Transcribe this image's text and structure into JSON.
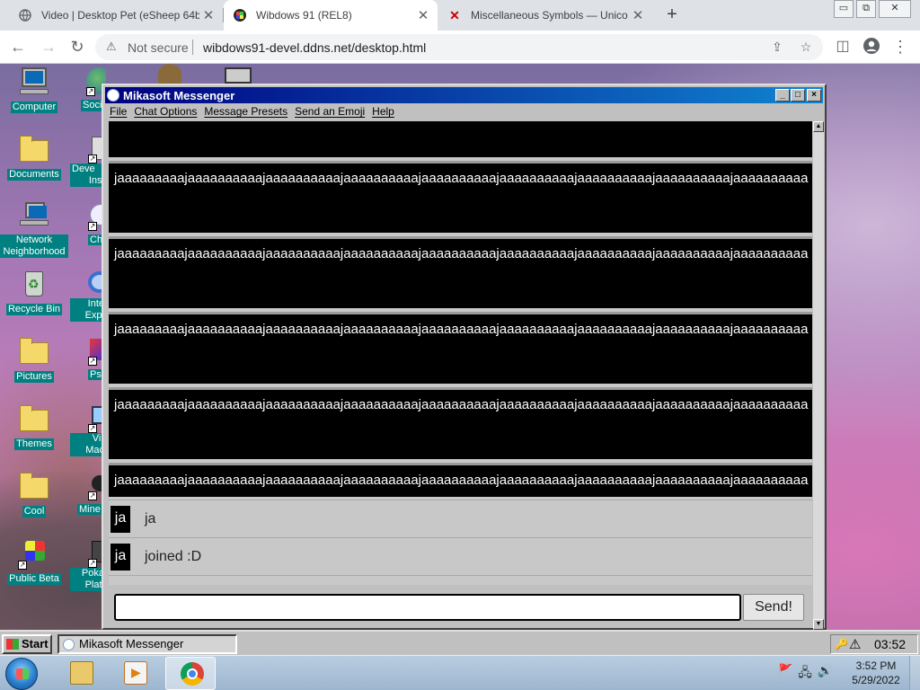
{
  "browser": {
    "tabs": [
      {
        "title": "Video | Desktop Pet (eSheep 64b",
        "active": false
      },
      {
        "title": "Wibdows 91 (REL8)",
        "active": true
      },
      {
        "title": "Miscellaneous Symbols — Unico",
        "active": false
      }
    ],
    "new_tab": "+",
    "window_controls": {
      "minimize": "▭",
      "restore": "⧉",
      "close": "✕"
    },
    "nav": {
      "back": "←",
      "forward": "→",
      "reload": "↻"
    },
    "address": {
      "security_label": "Not secure",
      "url": "wibdows91-devel.ddns.net/desktop.html"
    },
    "actions": {
      "share": "⇪",
      "bookmark": "☆",
      "sidepanel": "◫",
      "profile": "●",
      "menu": "⋮"
    }
  },
  "desktop": {
    "icons": [
      {
        "label": "Computer"
      },
      {
        "label": "Documents"
      },
      {
        "label": "Network Neighborhood"
      },
      {
        "label": "Recycle Bin"
      },
      {
        "label": "Pictures"
      },
      {
        "label": "Themes"
      },
      {
        "label": "Cool"
      },
      {
        "label": "Public Beta"
      }
    ],
    "partial_icons": [
      {
        "label": "Soci"
      },
      {
        "label": "Deve"
      },
      {
        "label": "Insi"
      },
      {
        "label": "Ch"
      },
      {
        "label": "Inte"
      },
      {
        "label": "Expl"
      },
      {
        "label": "Ps"
      },
      {
        "label": "Vir"
      },
      {
        "label": "Mac"
      },
      {
        "label": "Mine"
      },
      {
        "label": "Poka"
      },
      {
        "label": "Plati"
      }
    ]
  },
  "messenger": {
    "title": "Mikasoft Messenger",
    "window_buttons": {
      "minimize": "_",
      "maximize": "□",
      "close": "×"
    },
    "menu": [
      "File",
      "Chat Options",
      "Message Presets",
      "Send an Emoji",
      "Help"
    ],
    "long_messages": [
      "jaaaaaaaaajaaaaaaaaaajaaaaaaaaaajaaaaaaaaaajaaaaaaaaaajaaaaaaaaaajaaaaaaaaaajaaaaaaaaaajaaaaaaaaaa",
      "jaaaaaaaaajaaaaaaaaaajaaaaaaaaaajaaaaaaaaaajaaaaaaaaaajaaaaaaaaaajaaaaaaaaaajaaaaaaaaaajaaaaaaaaaa",
      "jaaaaaaaaajaaaaaaaaaajaaaaaaaaaajaaaaaaaaaajaaaaaaaaaajaaaaaaaaaajaaaaaaaaaajaaaaaaaaaajaaaaaaaaaa",
      "jaaaaaaaaajaaaaaaaaaajaaaaaaaaaajaaaaaaaaaajaaaaaaaaaajaaaaaaaaaajaaaaaaaaaajaaaaaaaaaajaaaaaaaaaa",
      "jaaaaaaaaajaaaaaaaaaajaaaaaaaaaajaaaaaaaaaajaaaaaaaaaajaaaaaaaaaajaaaaaaaaaajaaaaaaaaaajaaaaaaaaaa"
    ],
    "chat_lines": [
      {
        "avatar": "ja",
        "text": "ja"
      },
      {
        "avatar": "ja",
        "text": "joined :D"
      }
    ],
    "input": {
      "value": "",
      "placeholder": ""
    },
    "send_label": "Send!",
    "scroll_up": "▲",
    "scroll_down": "▼"
  },
  "wibdows_taskbar": {
    "start_label": "Start",
    "tasks": [
      {
        "label": "Mikasoft Messenger"
      }
    ],
    "tray_icons": [
      "🔑",
      "⚠"
    ],
    "clock": "03:52"
  },
  "win7_taskbar": {
    "pinned": [
      "Windows Explorer",
      "Windows Media Player",
      "Google Chrome"
    ],
    "tray_icons": [
      "🚩",
      "🖧",
      "🔊"
    ],
    "time": "3:52 PM",
    "date": "5/29/2022"
  }
}
